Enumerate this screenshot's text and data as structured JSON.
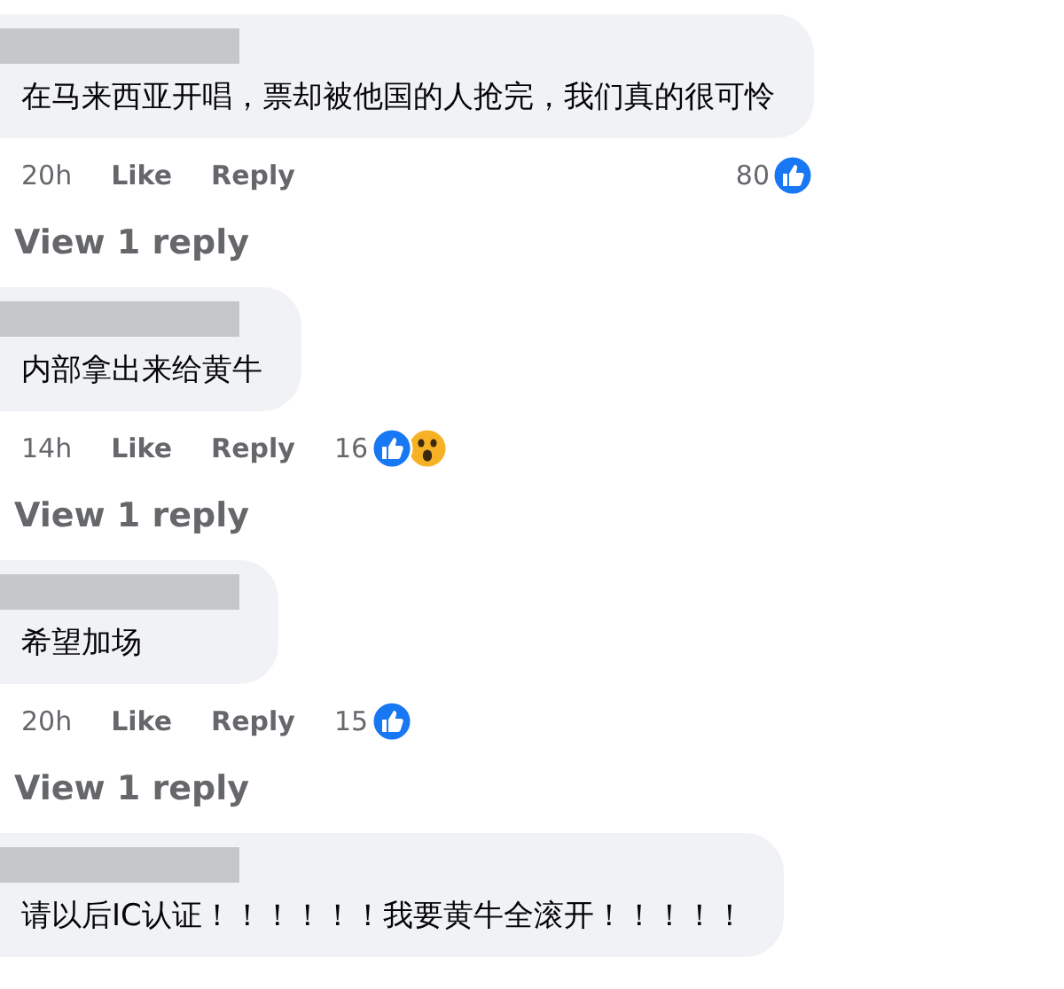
{
  "comments": [
    {
      "text": "在马来西亚开唱，票却被他国的人抢完，我们真的很可怜",
      "time": "20h",
      "like": "Like",
      "reply": "Reply",
      "reaction_count": "80",
      "reactions": [
        {
          "kind": "like"
        }
      ],
      "view_replies": "View 1 reply"
    },
    {
      "text": "内部拿出来给黄牛",
      "time": "14h",
      "like": "Like",
      "reply": "Reply",
      "reaction_count": "16",
      "reactions": [
        {
          "kind": "like"
        },
        {
          "kind": "wow"
        }
      ],
      "view_replies": "View 1 reply"
    },
    {
      "text": "希望加场",
      "time": "20h",
      "like": "Like",
      "reply": "Reply",
      "reaction_count": "15",
      "reactions": [
        {
          "kind": "like"
        }
      ],
      "view_replies": "View 1 reply"
    },
    {
      "text": "请以后IC认证！！！！！！我要黄牛全滚开！！！！！"
    }
  ]
}
